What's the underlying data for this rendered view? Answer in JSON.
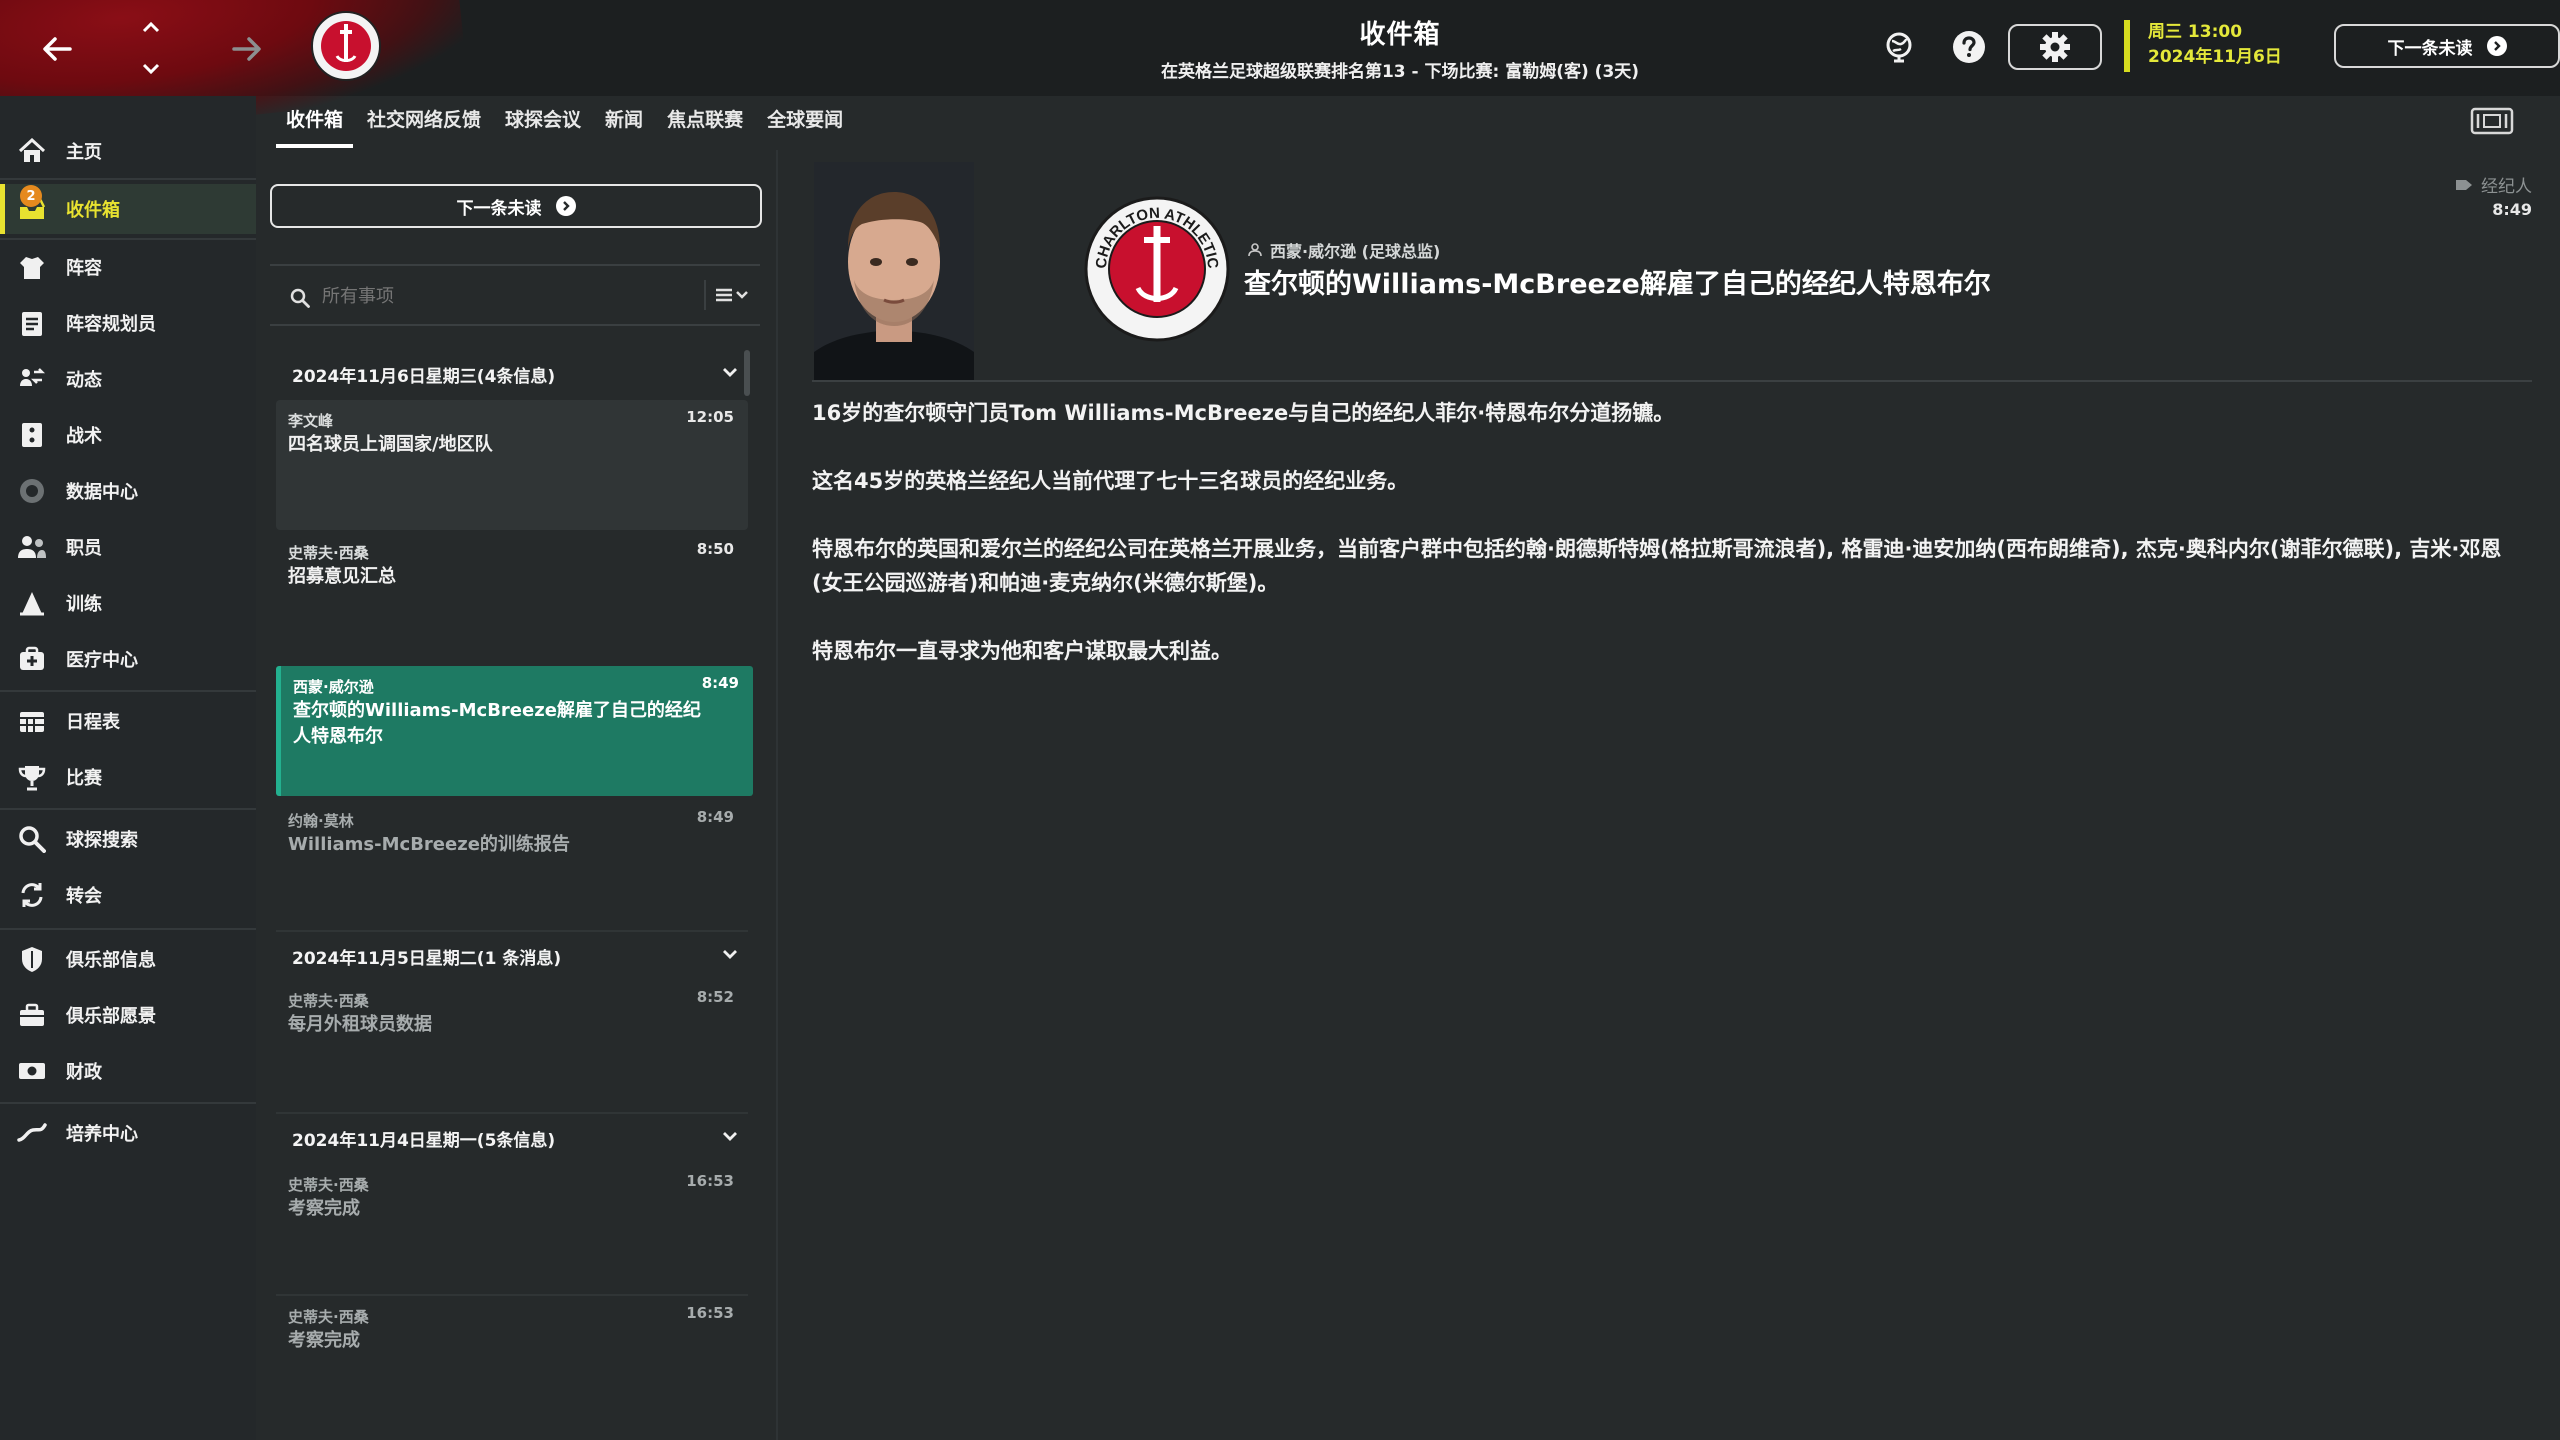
{
  "header": {
    "title": "收件箱",
    "subtitle": "在英格兰足球超级联赛排名第13 - 下场比赛: 富勒姆(客) (3天)",
    "date_line1": "周三 13:00",
    "date_line2": "2024年11月6日",
    "next_unread_label": "下一条未读",
    "club_crest_text": "CHARLTON ATHLETIC"
  },
  "sidebar": {
    "items": [
      {
        "label": "主页",
        "icon": "home-icon"
      },
      {
        "label": "收件箱",
        "icon": "inbox-icon",
        "badge": "2",
        "active": true
      },
      {
        "label": "阵容",
        "icon": "squad-icon"
      },
      {
        "label": "阵容规划员",
        "icon": "squad-planner-icon"
      },
      {
        "label": "动态",
        "icon": "dynamics-icon"
      },
      {
        "label": "战术",
        "icon": "tactics-icon"
      },
      {
        "label": "数据中心",
        "icon": "data-hub-icon"
      },
      {
        "label": "职员",
        "icon": "staff-icon"
      },
      {
        "label": "训练",
        "icon": "training-icon"
      },
      {
        "label": "医疗中心",
        "icon": "medical-icon"
      },
      {
        "label": "日程表",
        "icon": "calendar-icon"
      },
      {
        "label": "比赛",
        "icon": "trophy-icon"
      },
      {
        "label": "球探搜索",
        "icon": "scouting-icon"
      },
      {
        "label": "转会",
        "icon": "transfers-icon"
      },
      {
        "label": "俱乐部信息",
        "icon": "club-info-icon"
      },
      {
        "label": "俱乐部愿景",
        "icon": "club-vision-icon"
      },
      {
        "label": "财政",
        "icon": "finances-icon"
      },
      {
        "label": "培养中心",
        "icon": "development-icon"
      }
    ]
  },
  "tabs": [
    {
      "label": "收件箱",
      "active": true
    },
    {
      "label": "社交网络反馈"
    },
    {
      "label": "球探会议"
    },
    {
      "label": "新闻"
    },
    {
      "label": "焦点联赛"
    },
    {
      "label": "全球要闻"
    }
  ],
  "list": {
    "next_unread_label": "下一条未读",
    "search_placeholder": "所有事项",
    "groups": [
      {
        "title": "2024年11月6日星期三(4条信息)",
        "messages": [
          {
            "from": "李文峰",
            "time": "12:05",
            "subject": "四名球员上调国家/地区队"
          },
          {
            "from": "史蒂夫·西桑",
            "time": "8:50",
            "subject": "招募意见汇总"
          },
          {
            "from": "西蒙·威尔逊",
            "time": "8:49",
            "subject": "查尔顿的Williams-McBreeze解雇了自己的经纪人特恩布尔",
            "selected": true
          },
          {
            "from": "约翰·莫林",
            "time": "8:49",
            "subject": "Williams-McBreeze的训练报告"
          }
        ]
      },
      {
        "title": "2024年11月5日星期二(1 条消息)",
        "messages": [
          {
            "from": "史蒂夫·西桑",
            "time": "8:52",
            "subject": "每月外租球员数据"
          }
        ]
      },
      {
        "title": "2024年11月4日星期一(5条信息)",
        "messages": [
          {
            "from": "史蒂夫·西桑",
            "time": "16:53",
            "subject": "考察完成"
          },
          {
            "from": "史蒂夫·西桑",
            "time": "16:53",
            "subject": "考察完成"
          }
        ]
      }
    ]
  },
  "message": {
    "sender": "西蒙·威尔逊 (足球总监)",
    "headline": "查尔顿的Williams-McBreeze解雇了自己的经纪人特恩布尔",
    "category": "经纪人",
    "time": "8:49",
    "paragraphs": [
      "16岁的查尔顿守门员Tom Williams-McBreeze与自己的经纪人菲尔·特恩布尔分道扬镳。",
      "这名45岁的英格兰经纪人当前代理了七十三名球员的经纪业务。",
      "特恩布尔的英国和爱尔兰的经纪公司在英格兰开展业务，当前客户群中包括约翰·朗德斯特姆(格拉斯哥流浪者), 格雷迪·迪安加纳(西布朗维奇), 杰克·奥科内尔(谢菲尔德联), 吉米·邓恩(女王公园巡游者)和帕迪·麦克纳尔(米德尔斯堡)。",
      "特恩布尔一直寻求为他和客户谋取最大利益。"
    ]
  },
  "colors": {
    "accent_yellow": "#e8e230",
    "selected_green": "#1e7a63",
    "badge_orange": "#e58a1e",
    "club_red": "#c8102e"
  }
}
